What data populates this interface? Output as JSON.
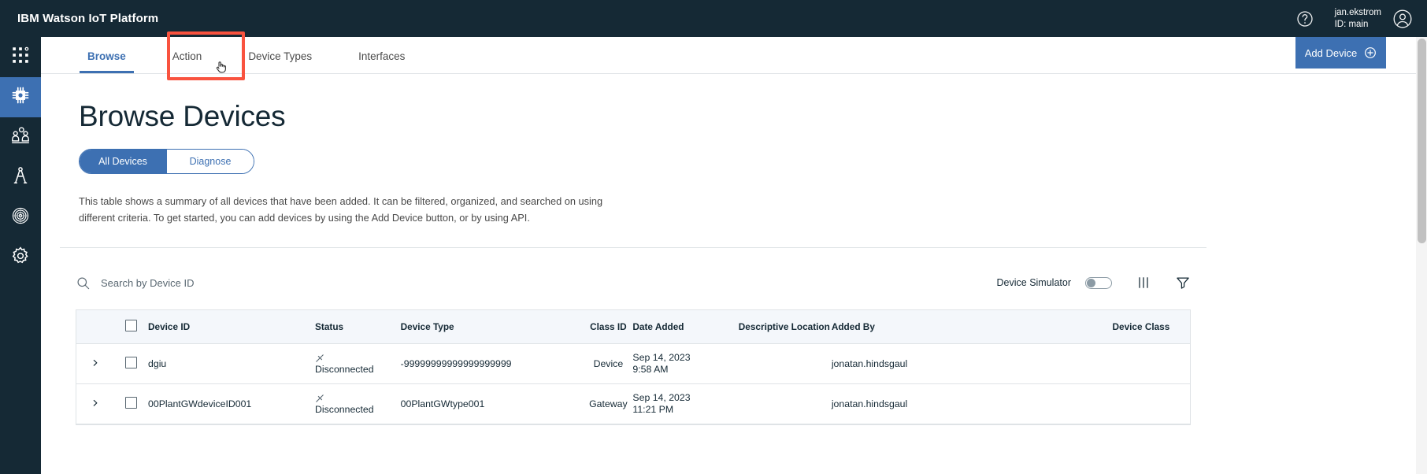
{
  "header": {
    "title": "IBM Watson IoT Platform",
    "help_icon": "help-circle-icon",
    "user_name": "jan.ekstrom",
    "user_id": "ID: main",
    "avatar_icon": "user-avatar-icon"
  },
  "rail": {
    "items": [
      {
        "icon": "app-grid-icon",
        "name": "apps-menu",
        "active": false
      },
      {
        "icon": "chip-icon",
        "name": "devices",
        "active": true
      },
      {
        "icon": "users-icon",
        "name": "members",
        "active": false
      },
      {
        "icon": "compass-icon",
        "name": "boards",
        "active": false
      },
      {
        "icon": "fingerprint-icon",
        "name": "security",
        "active": false
      },
      {
        "icon": "gear-icon",
        "name": "settings",
        "active": false
      }
    ]
  },
  "tabs": [
    {
      "label": "Browse",
      "active": true
    },
    {
      "label": "Action",
      "active": false
    },
    {
      "label": "Device Types",
      "active": false,
      "highlighted": true
    },
    {
      "label": "Interfaces",
      "active": false
    }
  ],
  "add_device": {
    "label": "Add Device",
    "icon": "plus-circle-icon",
    "color": "#3d70b2"
  },
  "page": {
    "title": "Browse Devices",
    "description": "This table shows a summary of all devices that have been added. It can be filtered, organized, and searched on using different criteria. To get started, you can add devices by using the Add Device button, or by using API."
  },
  "segmented": {
    "options": [
      {
        "label": "All Devices",
        "active": true
      },
      {
        "label": "Diagnose",
        "active": false
      }
    ]
  },
  "toolbar": {
    "search_placeholder": "Search by Device ID",
    "search_value": "",
    "search_icon": "search-icon",
    "simulator_label": "Device Simulator",
    "simulator_on": false,
    "columns_icon": "columns-icon",
    "filter_icon": "filter-icon"
  },
  "table": {
    "columns": [
      "Device ID",
      "Status",
      "Device Type",
      "Class ID",
      "Date Added",
      "Descriptive Location",
      "Added By",
      "Device Class"
    ],
    "rows": [
      {
        "device_id": "dgiu",
        "status": "Disconnected",
        "status_icon": "disconnected-icon",
        "device_type": "-99999999999999999999",
        "class_id": "Device",
        "date_added_line1": "Sep 14, 2023",
        "date_added_line2": "9:58 AM",
        "descriptive_location": "",
        "added_by": "jonatan.hindsgaul",
        "device_class": ""
      },
      {
        "device_id": "00PlantGWdeviceID001",
        "status": "Disconnected",
        "status_icon": "disconnected-icon",
        "device_type": "00PlantGWtype001",
        "class_id": "Gateway",
        "date_added_line1": "Sep 14, 2023",
        "date_added_line2": "11:21 PM",
        "descriptive_location": "",
        "added_by": "jonatan.hindsgaul",
        "device_class": ""
      }
    ]
  },
  "colors": {
    "brand_dark": "#152935",
    "accent_blue": "#3d70b2",
    "highlight_red": "#f9533f",
    "header_row_bg": "#f4f7fb",
    "border": "#dfe3e6"
  }
}
